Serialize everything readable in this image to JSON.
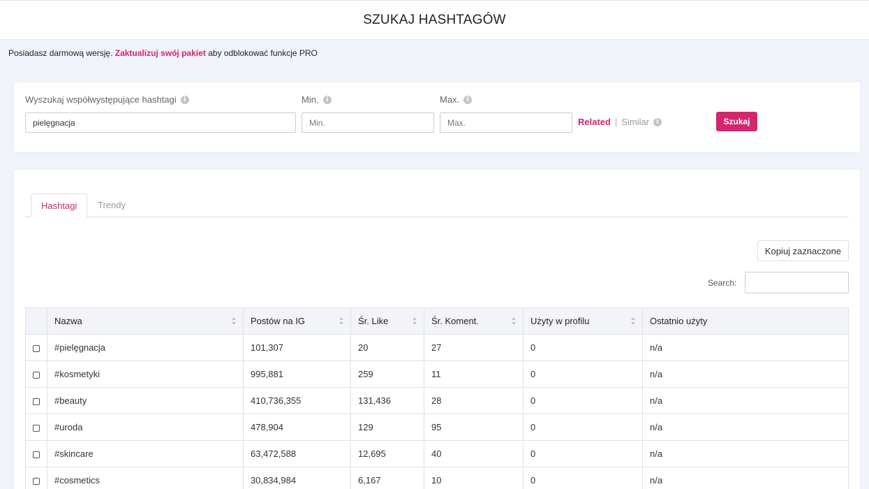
{
  "header": {
    "title": "SZUKAJ HASHTAGÓW"
  },
  "notice": {
    "text_before": "Posiadasz darmową wersję.",
    "link": "Zaktualizuj swój pakiet",
    "text_after": "aby odblokować funkcje PRO"
  },
  "search_form": {
    "hashtag_label": "Wyszukaj współwystępujące hashtagi",
    "hashtag_value": "pielęgnacja",
    "min_label": "Min.",
    "min_placeholder": "Min.",
    "max_label": "Max.",
    "max_placeholder": "Max.",
    "mode_related": "Related",
    "mode_separator": "|",
    "mode_similar": "Similar",
    "submit_label": "Szukaj"
  },
  "results": {
    "tabs": [
      {
        "label": "Hashtagi",
        "active": true
      },
      {
        "label": "Trendy",
        "active": false
      }
    ],
    "copy_button": "Kopiuj zaznaczone",
    "search_label": "Search:",
    "columns": [
      "Nazwa",
      "Postów na IG",
      "Śr. Like",
      "Śr. Koment.",
      "Użyty w profilu",
      "Ostatnio użyty"
    ],
    "rows": [
      [
        "#pielęgnacja",
        "101,307",
        "20",
        "27",
        "0",
        "n/a"
      ],
      [
        "#kosmetyki",
        "995,881",
        "259",
        "11",
        "0",
        "n/a"
      ],
      [
        "#beauty",
        "410,736,355",
        "131,436",
        "28",
        "0",
        "n/a"
      ],
      [
        "#uroda",
        "478,904",
        "129",
        "95",
        "0",
        "n/a"
      ],
      [
        "#skincare",
        "63,472,588",
        "12,695",
        "40",
        "0",
        "n/a"
      ],
      [
        "#cosmetics",
        "30,834,984",
        "6,167",
        "10",
        "0",
        "n/a"
      ]
    ]
  },
  "colors": {
    "accent": "#d6246e",
    "header_bg": "#f3f4f9",
    "page_bg": "#f1f3fa"
  }
}
